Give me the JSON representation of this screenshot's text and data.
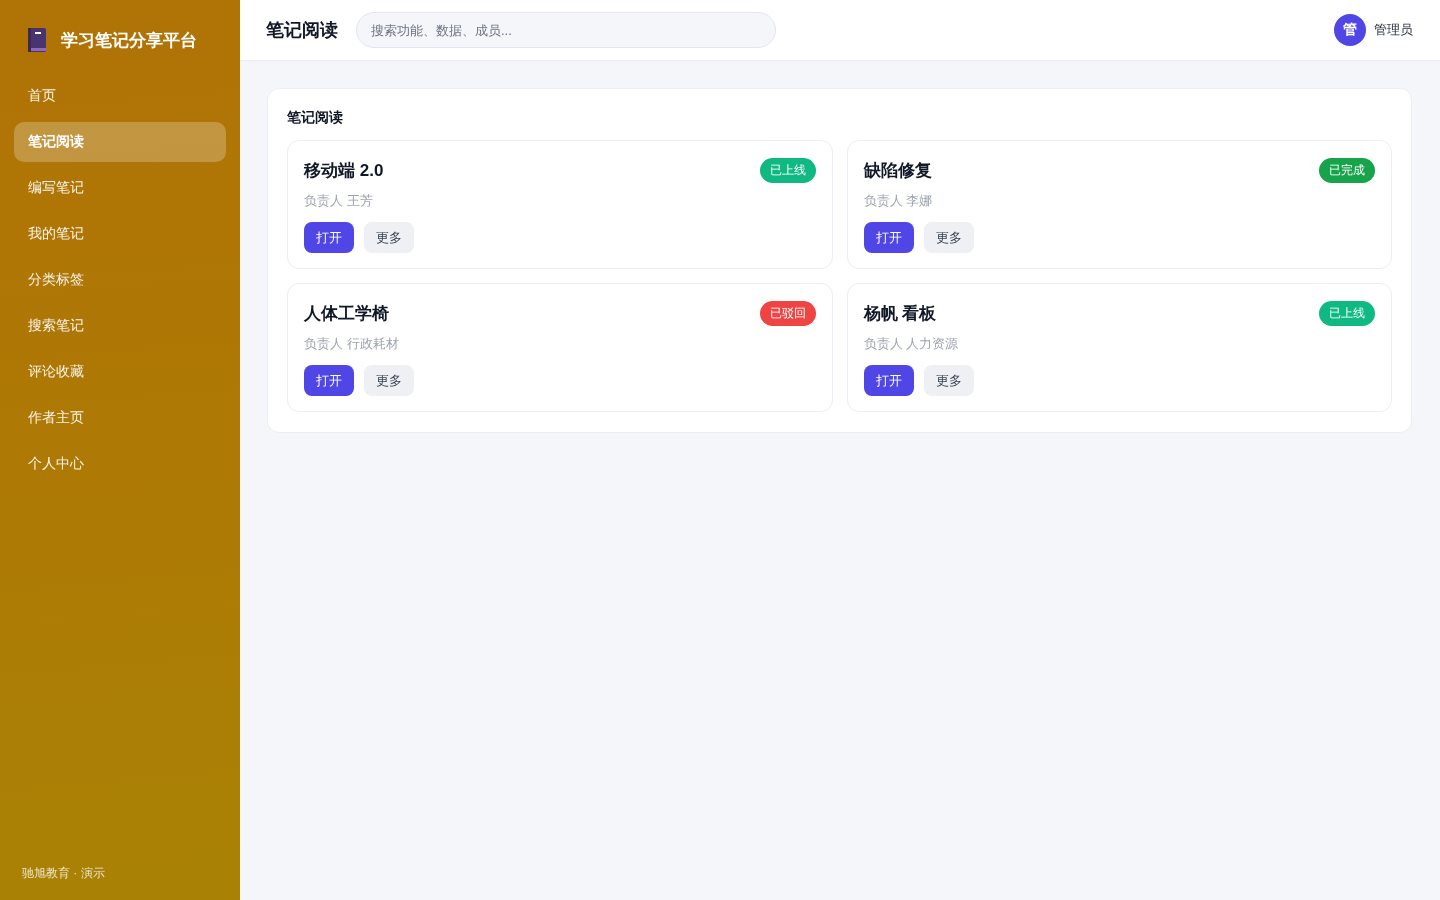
{
  "sidebar": {
    "brand": {
      "title": "学习笔记分享平台"
    },
    "items": [
      {
        "label": "首页",
        "selected": false
      },
      {
        "label": "笔记阅读",
        "selected": true
      },
      {
        "label": "编写笔记",
        "selected": false
      },
      {
        "label": "我的笔记",
        "selected": false
      },
      {
        "label": "分类标签",
        "selected": false
      },
      {
        "label": "搜索笔记",
        "selected": false
      },
      {
        "label": "评论收藏",
        "selected": false
      },
      {
        "label": "作者主页",
        "selected": false
      },
      {
        "label": "个人中心",
        "selected": false
      }
    ],
    "footer": "驰旭教育 · 演示"
  },
  "header": {
    "title": "笔记阅读",
    "search": {
      "placeholder": "搜索功能、数据、成员..."
    },
    "user": {
      "avatar": "管",
      "name": "管理员"
    }
  },
  "panel": {
    "title": "笔记阅读",
    "cards": [
      {
        "title": "移动端 2.0",
        "status": {
          "label": "已上线",
          "color": "#10b981"
        },
        "owner": "负责人 王芳",
        "buttons": [
          {
            "label": "打开",
            "kind": "primary"
          },
          {
            "label": "更多",
            "kind": "secondary"
          }
        ]
      },
      {
        "title": "缺陷修复",
        "status": {
          "label": "已完成",
          "color": "#16a34a"
        },
        "owner": "负责人 李娜",
        "buttons": [
          {
            "label": "打开",
            "kind": "primary"
          },
          {
            "label": "更多",
            "kind": "secondary"
          }
        ]
      },
      {
        "title": "人体工学椅",
        "status": {
          "label": "已驳回",
          "color": "#ef4444"
        },
        "owner": "负责人 行政耗材",
        "buttons": [
          {
            "label": "打开",
            "kind": "primary"
          },
          {
            "label": "更多",
            "kind": "secondary"
          }
        ]
      },
      {
        "title": "杨帆 看板",
        "status": {
          "label": "已上线",
          "color": "#10b981"
        },
        "owner": "负责人 人力资源",
        "buttons": [
          {
            "label": "打开",
            "kind": "primary"
          },
          {
            "label": "更多",
            "kind": "secondary"
          }
        ]
      }
    ]
  }
}
